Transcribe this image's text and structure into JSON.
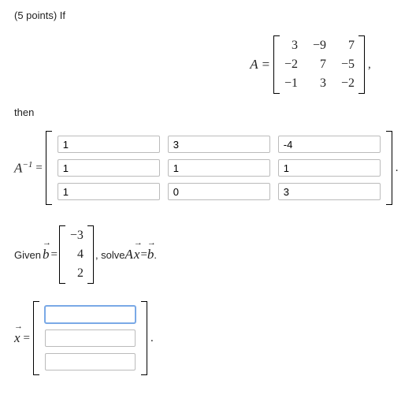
{
  "header": {
    "points": "(5 points) If"
  },
  "matrixA": {
    "label": "A =",
    "rows": [
      [
        "3",
        "−9",
        "7"
      ],
      [
        "−2",
        "7",
        "−5"
      ],
      [
        "−1",
        "3",
        "−2"
      ]
    ],
    "trailing": ","
  },
  "then": "then",
  "invA": {
    "label_html": "A",
    "sup": "−1",
    "eq": " =",
    "values": [
      [
        "1",
        "3",
        "-4"
      ],
      [
        "1",
        "1",
        "1"
      ],
      [
        "1",
        "0",
        "3"
      ]
    ],
    "trailing": "."
  },
  "given": {
    "prefix": "Given ",
    "bvar": "b",
    "eq1": " = ",
    "bvec": [
      "−3",
      "4",
      "2"
    ],
    "mid": ", solve ",
    "Avar": "A",
    "xvar": "x",
    "eq2": " = ",
    "bvar2": "b",
    "end": "."
  },
  "xsol": {
    "xvar": "x",
    "eq": " =",
    "values": [
      "",
      "",
      ""
    ],
    "trailing": "."
  },
  "chart_data": {
    "type": "table",
    "A": [
      [
        3,
        -9,
        7
      ],
      [
        -2,
        7,
        -5
      ],
      [
        -1,
        3,
        -2
      ]
    ],
    "A_inverse_inputs": [
      [
        1,
        3,
        -4
      ],
      [
        1,
        1,
        1
      ],
      [
        1,
        0,
        3
      ]
    ],
    "b": [
      -3,
      4,
      2
    ],
    "x_inputs": [
      null,
      null,
      null
    ]
  }
}
